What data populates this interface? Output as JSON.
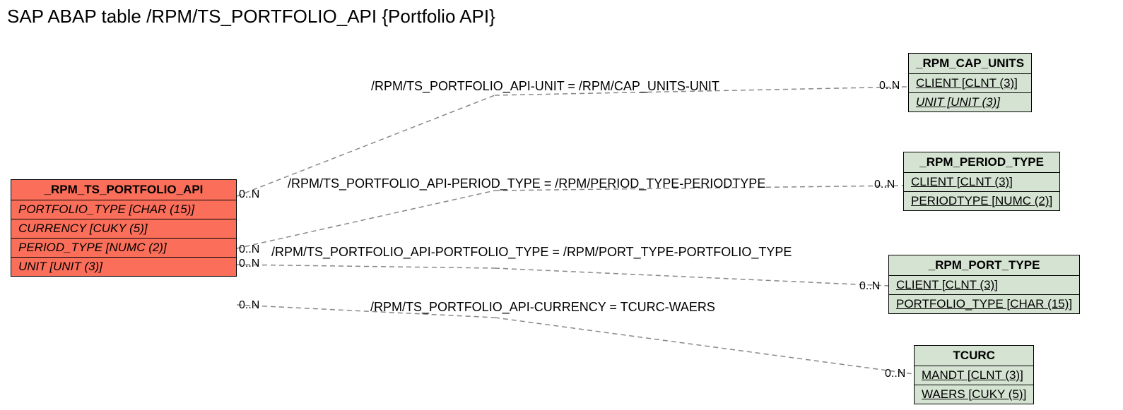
{
  "title": "SAP ABAP table /RPM/TS_PORTFOLIO_API {Portfolio API}",
  "source_entity": {
    "name": "_RPM_TS_PORTFOLIO_API",
    "rows": [
      "PORTFOLIO_TYPE [CHAR (15)]",
      "CURRENCY [CUKY (5)]",
      "PERIOD_TYPE [NUMC (2)]",
      "UNIT [UNIT (3)]"
    ]
  },
  "targets": [
    {
      "name": "_RPM_CAP_UNITS",
      "rows": [
        "CLIENT [CLNT (3)]",
        "UNIT [UNIT (3)]"
      ],
      "row_styles": [
        "ul",
        "ul it"
      ]
    },
    {
      "name": "_RPM_PERIOD_TYPE",
      "rows": [
        "CLIENT [CLNT (3)]",
        "PERIODTYPE [NUMC (2)]"
      ],
      "row_styles": [
        "ul",
        "ul"
      ]
    },
    {
      "name": "_RPM_PORT_TYPE",
      "rows": [
        "CLIENT [CLNT (3)]",
        "PORTFOLIO_TYPE [CHAR (15)]"
      ],
      "row_styles": [
        "ul",
        "ul"
      ]
    },
    {
      "name": "TCURC",
      "rows": [
        "MANDT [CLNT (3)]",
        "WAERS [CUKY (5)]"
      ],
      "row_styles": [
        "ul",
        "ul"
      ]
    }
  ],
  "relations": [
    {
      "label": "/RPM/TS_PORTFOLIO_API-UNIT = /RPM/CAP_UNITS-UNIT",
      "left_card": "0..N",
      "right_card": "0..N"
    },
    {
      "label": "/RPM/TS_PORTFOLIO_API-PERIOD_TYPE = /RPM/PERIOD_TYPE-PERIODTYPE",
      "left_card": "0..N",
      "right_card": "0..N"
    },
    {
      "label": "/RPM/TS_PORTFOLIO_API-PORTFOLIO_TYPE = /RPM/PORT_TYPE-PORTFOLIO_TYPE",
      "left_card": "0..N",
      "right_card": "0..N"
    },
    {
      "label": "/RPM/TS_PORTFOLIO_API-CURRENCY = TCURC-WAERS",
      "left_card": "0..N",
      "right_card": "0..N"
    }
  ]
}
